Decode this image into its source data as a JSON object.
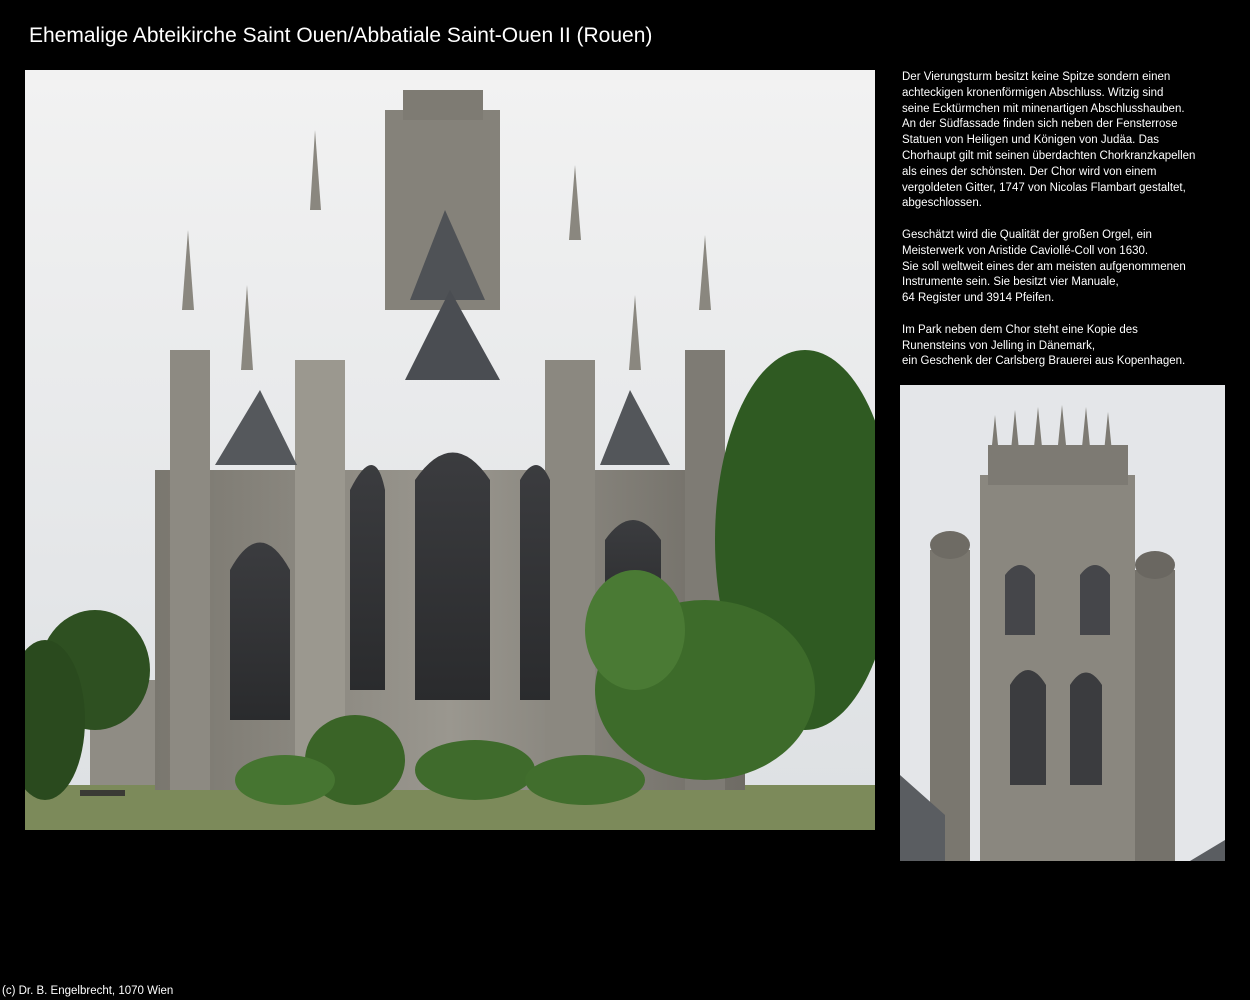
{
  "page": {
    "title": "Ehemalige Abteikirche Saint Ouen/Abbatiale Saint-Ouen II (Rouen)",
    "copyright": "(c) Dr. B. Engelbrecht, 1070 Wien"
  },
  "description": {
    "paragraphs": [
      {
        "lines": [
          "Der Vierungsturm besitzt keine Spitze sondern einen",
          "achteckigen kronenförmigen Abschluss. Witzig sind",
          "seine Ecktürmchen mit minenartigen Abschlusshauben.",
          "An der Südfassade finden sich neben der Fensterrose",
          "Statuen von Heiligen und Königen von Judäa. Das",
          "Chorhaupt gilt mit seinen überdachten Chorkranzkapellen",
          "als eines der schönsten. Der Chor wird von einem",
          "vergoldeten Gitter, 1747 von Nicolas Flambart gestaltet,",
          "abgeschlossen."
        ]
      },
      {
        "lines": [
          "Geschätzt wird die Qualität der großen Orgel, ein",
          "Meisterwerk von Aristide Caviollé-Coll von 1630.",
          "Sie soll weltweit eines der am meisten aufgenommenen",
          "Instrumente sein. Sie besitzt vier Manuale,",
          "64 Register und 3914 Pfeifen."
        ]
      },
      {
        "lines": [
          "Im Park neben dem Chor steht eine Kopie des",
          "Runensteins von Jelling in Dänemark,",
          "ein Geschenk der Carlsberg Brauerei aus Kopenhagen."
        ]
      }
    ]
  },
  "colors": {
    "background": "#000000",
    "text": "#ffffff",
    "sky": "#e6e8ea",
    "stone": "#8a8780",
    "roof": "#4f5256",
    "foliage": "#3d6b2a",
    "lawn": "#7c8a5a"
  }
}
